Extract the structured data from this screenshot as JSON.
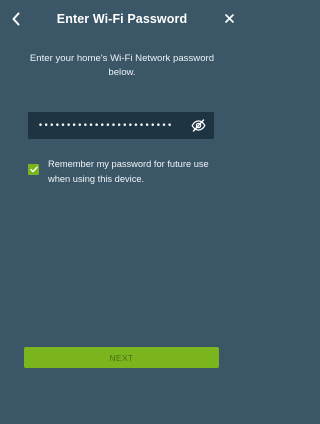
{
  "header": {
    "title": "Enter Wi-Fi Password",
    "back_icon": "chevron-left-icon",
    "close_icon": "close-icon"
  },
  "instructions": "Enter your home's Wi-Fi Network password below.",
  "password": {
    "masked_value": "••••••••••••••••••••••••",
    "toggle_icon": "eye-slash-icon"
  },
  "remember": {
    "checked": true,
    "label": "Remember my password for future use when using this device."
  },
  "next_button": {
    "label": "NEXT"
  },
  "colors": {
    "background": "#3a5667",
    "field": "#1f3442",
    "accent": "#7ab51d",
    "button_text": "#4c6f18"
  }
}
